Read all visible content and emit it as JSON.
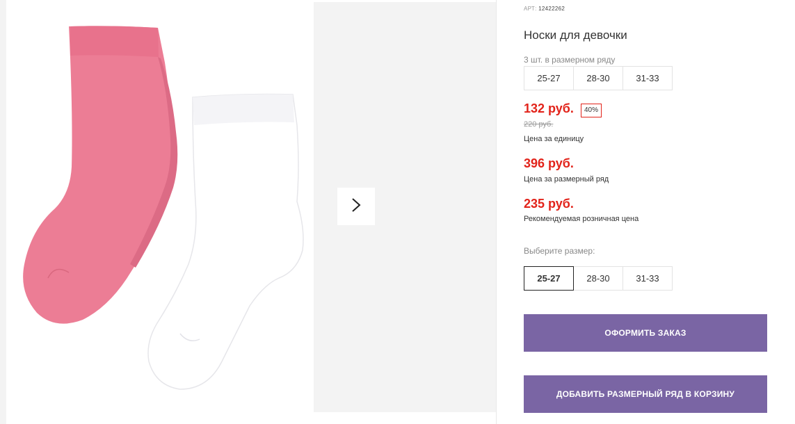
{
  "gallery": {
    "next_icon": "chevron-right-icon",
    "image_alt_colors": {
      "pink_sock": "#ec7d95",
      "white_sock": "#ffffff"
    }
  },
  "product": {
    "art_label": "АРТ:",
    "art_value": "12422262",
    "title": "Носки для девочки",
    "pack_label": "3 шт. в размерном ряду",
    "pack_sizes": [
      "25-27",
      "28-30",
      "31-33"
    ],
    "unit_price": "132 руб.",
    "discount_badge": "40%",
    "old_price": "220 руб.",
    "unit_price_note": "Цена за единицу",
    "pack_price": "396 руб.",
    "pack_price_note": "Цена за размерный ряд",
    "retail_price": "235 руб.",
    "retail_price_note": "Рекомендуемая розничная цена",
    "choose_size_label": "Выберите размер:",
    "select_sizes": [
      "25-27",
      "28-30",
      "31-33"
    ],
    "selected_size": "25-27"
  },
  "actions": {
    "order_label": "ОФОРМИТЬ ЗАКАЗ",
    "add_to_cart_label": "ДОБАВИТЬ РАЗМЕРНЫЙ РЯД В КОРЗИНУ"
  },
  "colors": {
    "accent_red": "#e2231a",
    "button_purple": "#7a65a4"
  }
}
